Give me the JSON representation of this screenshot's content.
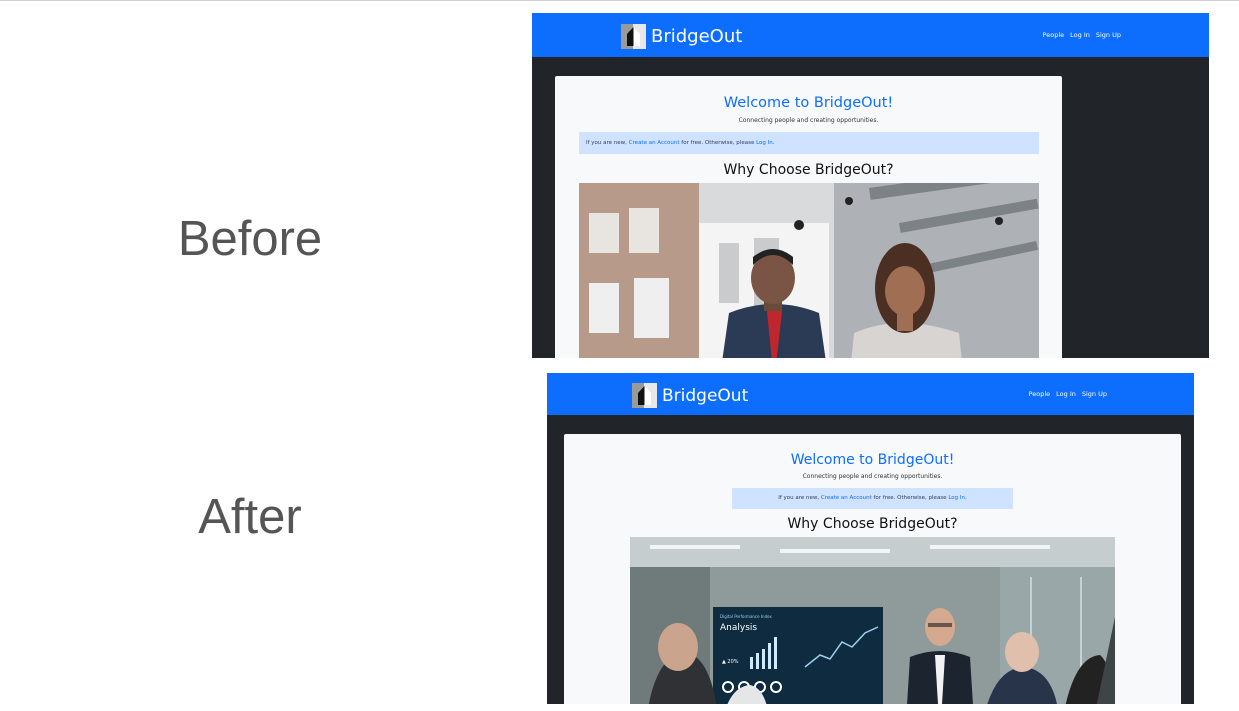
{
  "labels": {
    "before": "Before",
    "after": "After"
  },
  "site": {
    "brand": "BridgeOut",
    "nav": [
      "People",
      "Log In",
      "Sign Up"
    ],
    "welcome": "Welcome to BridgeOut!",
    "tagline": "Connecting people and creating opportunities.",
    "alert": {
      "prefix": "If you are new, ",
      "create_link": "Create an Account",
      "middle": " for free. Otherwise, please ",
      "login_link": "Log In",
      "suffix": "."
    },
    "why_heading": "Why Choose BridgeOut?"
  },
  "after_photo": {
    "screen_title": "Analysis",
    "screen_small": "Digital Performance Index",
    "screen_stat": "▲ 20%"
  },
  "colors": {
    "primary": "#0d6efd",
    "dark_bg": "#212529",
    "alert_bg": "#cfe2ff",
    "card_bg": "#f8f9fa"
  }
}
